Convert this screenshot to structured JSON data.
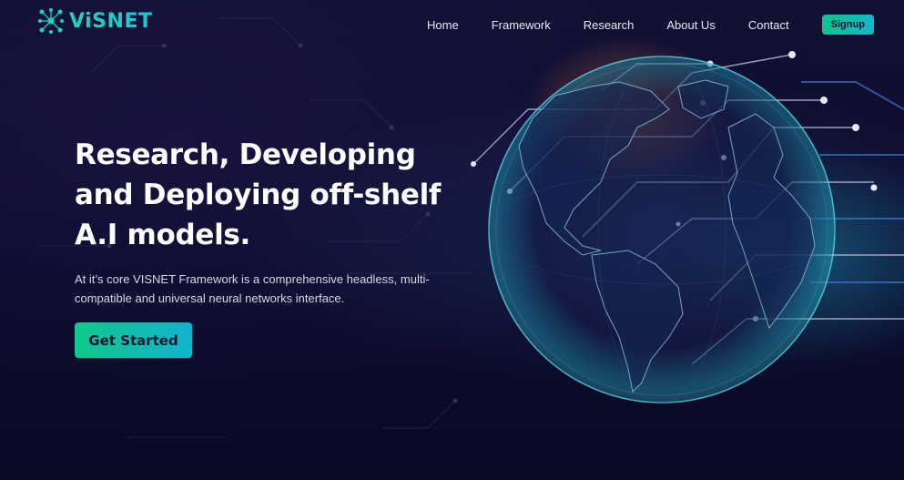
{
  "brand": {
    "name": "ViSNET",
    "logo_icon": "network-nodes-icon",
    "accent": "#14c9a6"
  },
  "nav": {
    "items": [
      {
        "label": "Home"
      },
      {
        "label": "Framework"
      },
      {
        "label": "Research"
      },
      {
        "label": "About Us"
      },
      {
        "label": "Contact"
      }
    ],
    "signup_label": "Signup"
  },
  "hero": {
    "title_line1": "Research, Developing",
    "title_line2": "and Deploying off-shelf",
    "title_line3": "A.I models.",
    "subtitle": "At it’s core VISNET Framework is a comprehensive headless, multi-compatible and universal neural networks interface.",
    "cta_label": "Get Started"
  },
  "colors": {
    "background": "#0c0b2c",
    "button_gradient_start": "#10c88a",
    "button_gradient_end": "#12b3cf",
    "globe_glow": "#2ea9c4"
  }
}
